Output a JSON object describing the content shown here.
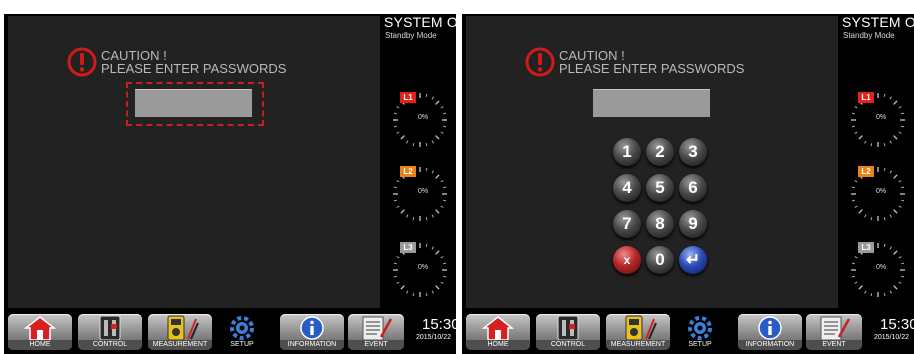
{
  "screens": [
    {
      "system": {
        "title": "SYSTEM ON",
        "subtitle": "Standby Mode"
      },
      "caution": {
        "line1": "CAUTION !",
        "line2": "PLEASE ENTER PASSWORDS"
      },
      "password": {
        "value": ""
      },
      "gauges": [
        {
          "label": "L1",
          "percent": "0%",
          "level": 0,
          "color": "#e3201b"
        },
        {
          "label": "L2",
          "percent": "0%",
          "level": 0,
          "color": "#e8821a"
        },
        {
          "label": "L3",
          "percent": "0%",
          "level": 0,
          "color": "#9a9a9a"
        }
      ],
      "nav": {
        "home": "HOME",
        "control": "CONTROL",
        "measurement": "MEASUREMENT",
        "setup": "SETUP",
        "information": "INFORMATION",
        "event": "EVENT"
      },
      "clock": {
        "time": "15:30",
        "date": "2015/10/22"
      }
    },
    {
      "system": {
        "title": "SYSTEM ON",
        "subtitle": "Standby Mode"
      },
      "caution": {
        "line1": "CAUTION !",
        "line2": "PLEASE ENTER PASSWORDS"
      },
      "password": {
        "value": ""
      },
      "keypad": [
        "1",
        "2",
        "3",
        "4",
        "5",
        "6",
        "7",
        "8",
        "9",
        "x",
        "0",
        "↵"
      ],
      "gauges": [
        {
          "label": "L1",
          "percent": "0%",
          "level": 0,
          "color": "#e3201b"
        },
        {
          "label": "L2",
          "percent": "0%",
          "level": 0,
          "color": "#e8821a"
        },
        {
          "label": "L3",
          "percent": "0%",
          "level": 0,
          "color": "#9a9a9a"
        }
      ],
      "nav": {
        "home": "HOME",
        "control": "CONTROL",
        "measurement": "MEASUREMENT",
        "setup": "SETUP",
        "information": "INFORMATION",
        "event": "EVENT"
      },
      "clock": {
        "time": "15:30",
        "date": "2015/10/22"
      }
    }
  ],
  "icons": {
    "caution": "caution-icon",
    "home": "home-icon",
    "control": "breaker-icon",
    "measurement": "multimeter-icon",
    "setup": "gear-icon",
    "information": "info-icon",
    "event": "event-log-icon",
    "clear": "clear-icon",
    "enter": "enter-icon"
  }
}
